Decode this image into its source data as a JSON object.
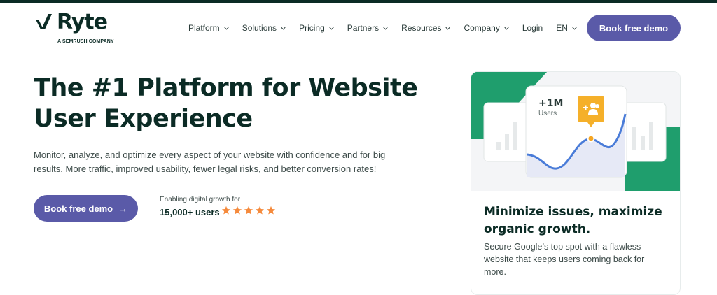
{
  "brand": {
    "name": "Ryte",
    "tagline": "A SEMRUSH COMPANY"
  },
  "nav": {
    "items": [
      {
        "label": "Platform",
        "has_dropdown": true
      },
      {
        "label": "Solutions",
        "has_dropdown": true
      },
      {
        "label": "Pricing",
        "has_dropdown": true
      },
      {
        "label": "Partners",
        "has_dropdown": true
      },
      {
        "label": "Resources",
        "has_dropdown": true
      },
      {
        "label": "Company",
        "has_dropdown": true
      },
      {
        "label": "Login",
        "has_dropdown": false
      },
      {
        "label": "EN",
        "has_dropdown": true
      }
    ],
    "cta_label": "Book free demo"
  },
  "hero": {
    "title": "The #1 Platform for Website User Experience",
    "description": "Monitor, analyze, and optimize every aspect of your website with confidence and for big results. More traffic, improved usability, fewer legal risks, and better conversion rates!",
    "cta_label": "Book free demo",
    "cta_icon": "arrow-right-icon",
    "growth_caption": "Enabling digital growth for",
    "growth_users": "15,000+ users",
    "rating_stars": 5
  },
  "card": {
    "stat_value": "+1M",
    "stat_label": "Users",
    "stat_icon": "users-add-icon",
    "title": "Minimize issues, maximize organic growth.",
    "description": "Secure Google’s top spot with a flawless website that keeps users coming back for more."
  },
  "colors": {
    "brand_dark": "#0b2b25",
    "primary_button": "#5a5aa8",
    "accent_green": "#1f9e6d",
    "accent_orange": "#f5a623",
    "star": "#f58a3c"
  }
}
